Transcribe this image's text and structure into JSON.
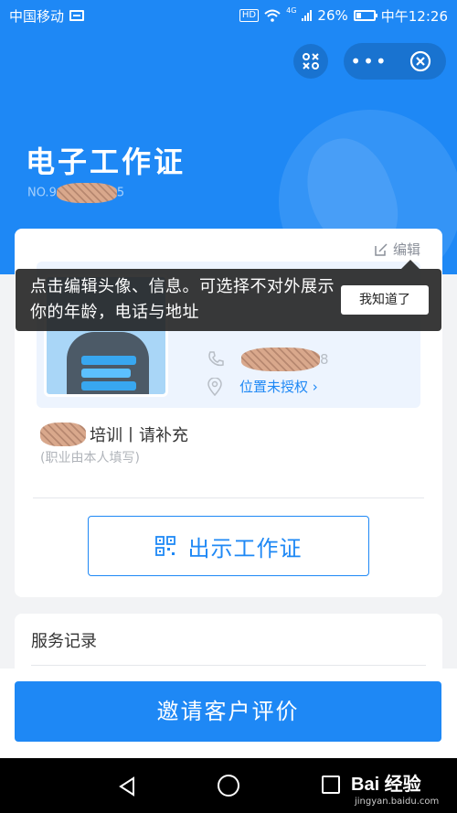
{
  "status_bar": {
    "carrier": "中国移动",
    "network": "4G",
    "battery": "26%",
    "time": "中午12:26"
  },
  "header": {
    "title": "电子工作证",
    "number_prefix": "NO.9",
    "number_suffix": "5"
  },
  "card": {
    "edit_label": "编辑",
    "phone_suffix": "8",
    "location_label": "位置未授权",
    "job_line": "培训丨请补充",
    "job_hint": "(职业由本人填写)",
    "show_button": "出示工作证"
  },
  "tooltip": {
    "message": "点击编辑头像、信息。可选择不对外展示你的年龄，电话与地址",
    "confirm": "我知道了"
  },
  "service": {
    "title": "服务记录"
  },
  "footer": {
    "cta": "邀请客户评价"
  },
  "watermark": {
    "brand": "Bai 经验",
    "site": "jingyan.baidu.com"
  },
  "colors": {
    "primary": "#1e88f5",
    "background": "#f2f3f5"
  }
}
